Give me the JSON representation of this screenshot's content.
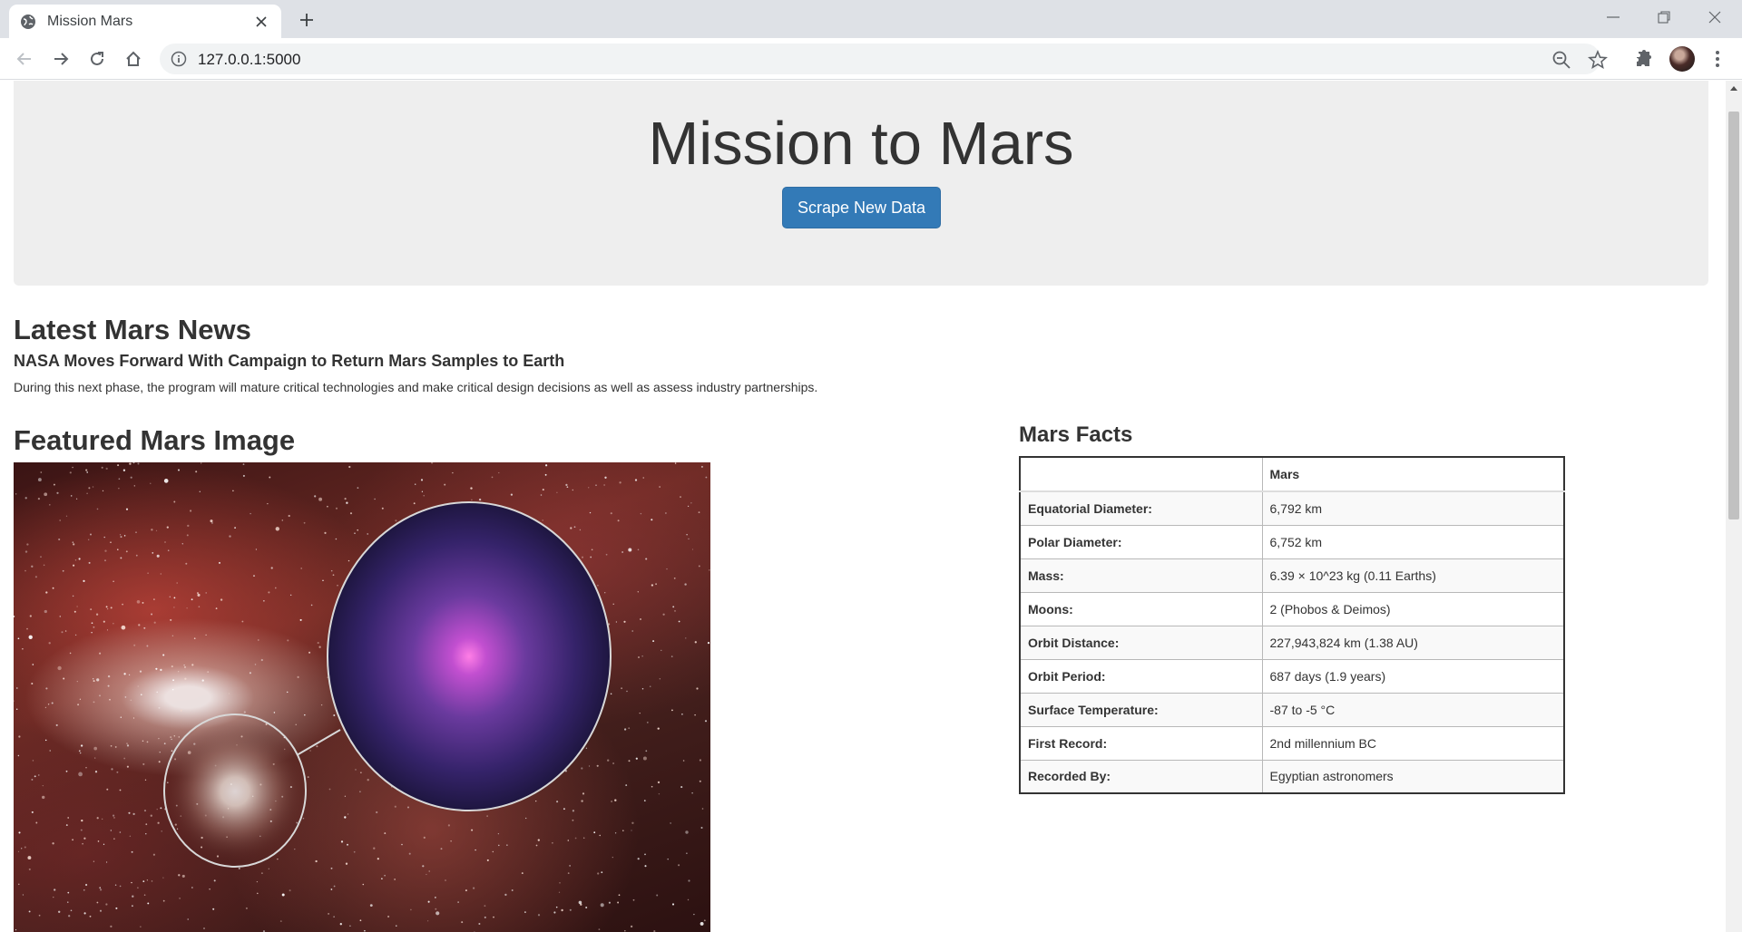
{
  "browser": {
    "tab_title": "Mission Mars",
    "url": "127.0.0.1:5000",
    "icons": [
      "globe-icon",
      "close-icon",
      "plus-icon",
      "back-icon",
      "forward-icon",
      "reload-icon",
      "home-icon",
      "info-icon",
      "zoom-icon",
      "star-icon",
      "extensions-icon",
      "avatar",
      "menu-icon"
    ]
  },
  "jumbotron": {
    "title": "Mission to Mars",
    "button_label": "Scrape New Data",
    "button_color": "#337ab7"
  },
  "news": {
    "heading": "Latest Mars News",
    "title": "NASA Moves Forward With Campaign to Return Mars Samples to Earth",
    "paragraph": "During this next phase, the program will mature critical technologies and make critical design decisions as well as assess industry partnerships."
  },
  "featured": {
    "heading": "Featured Mars Image"
  },
  "facts": {
    "heading": "Mars Facts",
    "header": [
      "",
      "Mars"
    ],
    "rows": [
      [
        "Equatorial Diameter:",
        "6,792 km"
      ],
      [
        "Polar Diameter:",
        "6,752 km"
      ],
      [
        "Mass:",
        "6.39 × 10^23 kg (0.11 Earths)"
      ],
      [
        "Moons:",
        "2 (Phobos & Deimos)"
      ],
      [
        "Orbit Distance:",
        "227,943,824 km (1.38 AU)"
      ],
      [
        "Orbit Period:",
        "687 days (1.9 years)"
      ],
      [
        "Surface Temperature:",
        "-87 to -5 °C"
      ],
      [
        "First Record:",
        "2nd millennium BC"
      ],
      [
        "Recorded By:",
        "Egyptian astronomers"
      ]
    ]
  }
}
